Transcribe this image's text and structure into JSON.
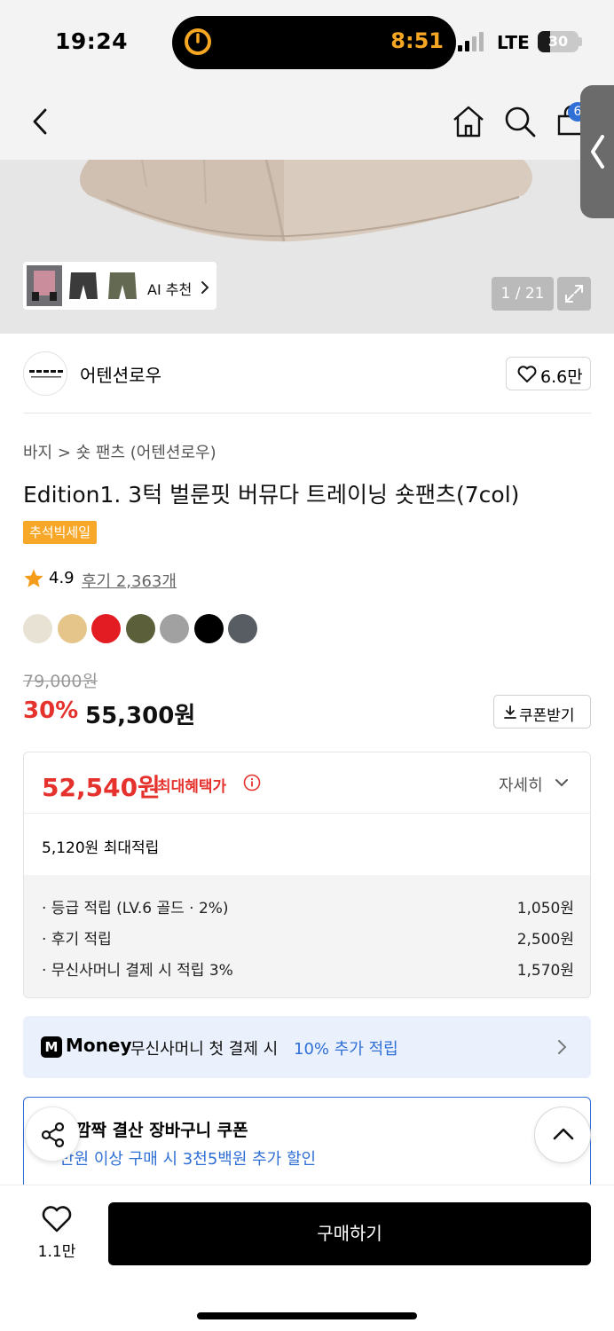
{
  "status_bar": {
    "time": "19:24",
    "timer": "8:51",
    "network": "LTE",
    "battery": "30",
    "battery_level": 0.3
  },
  "header": {
    "cart_count": "6"
  },
  "gallery": {
    "ai_label": "AI 추천",
    "counter": "1 / 21"
  },
  "brand": {
    "name": "어텐션로우",
    "likes": "6.6만"
  },
  "product": {
    "breadcrumb": "바지 > 숏 팬츠 (어텐션로우)",
    "title": "Edition1. 3턱 벌룬핏 버뮤다 트레이닝 숏팬츠(7col)",
    "badge": "추석빅세일",
    "rating": "4.9",
    "reviews": "후기 2,363개",
    "swatches": [
      "#e8e2d4",
      "#e6c58b",
      "#e31b23",
      "#5b5f3a",
      "#a1a1a1",
      "#000000",
      "#585c63"
    ]
  },
  "price": {
    "original": "79,000원",
    "discount": "30%",
    "sale": "55,300원",
    "coupon_button": "쿠폰받기"
  },
  "benefit": {
    "max_price": "52,540원",
    "max_label": "최대혜택가",
    "detail_label": "자세히",
    "points_total": "5,120원 최대적립",
    "points": [
      {
        "label": "· 등급 적립 (LV.6 골드 · 2%)",
        "value": "1,050원"
      },
      {
        "label": "· 후기 적립",
        "value": "2,500원"
      },
      {
        "label": "· 무신사머니 결제 시 적립 3%",
        "value": "1,570원"
      }
    ]
  },
  "money_banner": {
    "logo": "M",
    "brand": "Money",
    "text": "무신사머니 첫 결제 시",
    "accent": "10% 추가 적립"
  },
  "cart_coupon": {
    "title": "깜짝 결산 장바구니 쿠폰",
    "desc": "만원 이상 구매 시 3천5백원 추가 할인"
  },
  "bottom": {
    "wish_count": "1.1만",
    "buy_label": "구매하기"
  }
}
